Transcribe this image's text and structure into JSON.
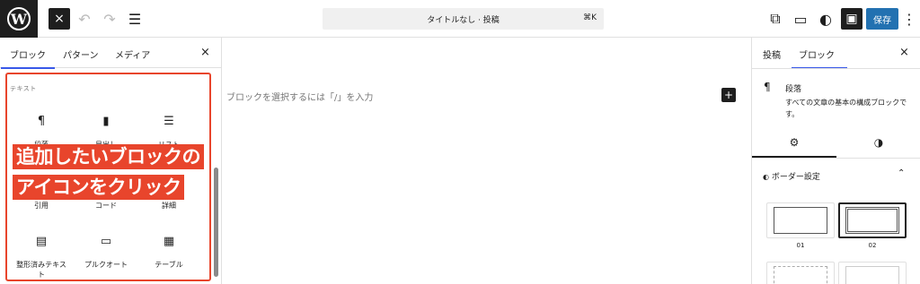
{
  "topbar": {
    "wp_logo": "W",
    "close_icon": "×",
    "undo_icon": "↶",
    "redo_icon": "↷",
    "list_icon": "☰",
    "doc_title": "タイトルなし · 投稿",
    "shortcut": "⌘K",
    "preview_icon": "⧉",
    "device_icon": "▭",
    "jetpack_icon": "◐",
    "settings_icon": "▣",
    "save_label": "保存",
    "more_icon": "⋮"
  },
  "inserter": {
    "tabs": [
      "ブロック",
      "パターン",
      "メディア"
    ],
    "close_icon": "×",
    "section": "テキスト",
    "blocks": [
      {
        "label": "段落",
        "icon": "¶"
      },
      {
        "label": "見出し",
        "icon": "▮"
      },
      {
        "label": "リスト",
        "icon": "☰"
      },
      {
        "label": "引用",
        "icon": "❝"
      },
      {
        "label": "コード",
        "icon": "‹›"
      },
      {
        "label": "詳細",
        "icon": "☷"
      },
      {
        "label": "整形済みテキスト",
        "icon": "▤"
      },
      {
        "label": "プルクオート",
        "icon": "▭"
      },
      {
        "label": "テーブル",
        "icon": "▦"
      }
    ],
    "annotation_line1": "追加したいブロックの",
    "annotation_line2": "アイコンをクリック"
  },
  "canvas": {
    "placeholder": "ブロックを選択するには「/」を入力",
    "add_icon": "+"
  },
  "sidebar": {
    "tabs": [
      "投稿",
      "ブロック"
    ],
    "close_icon": "×",
    "block_icon": "¶",
    "block_title": "段落",
    "block_desc": "すべての文章の基本の構成ブロックです。",
    "settings_tab_icon": "⚙",
    "styles_tab_icon": "◑",
    "border_heading": "ボーダー設定",
    "chevron_icon": "⌃",
    "border_styles": [
      "01",
      "02"
    ]
  }
}
